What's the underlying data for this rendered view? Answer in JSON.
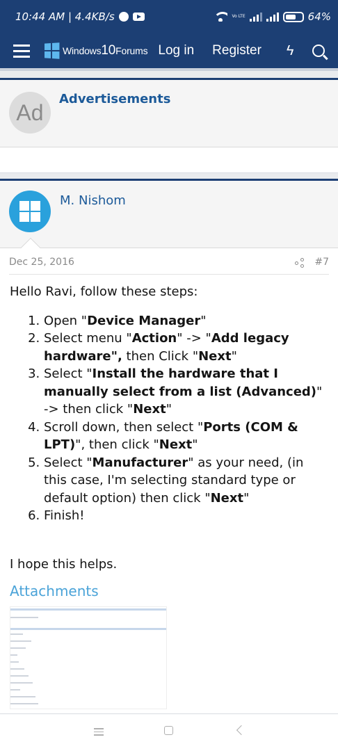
{
  "status_bar": {
    "time_speed": "10:44 AM | 4.4KB/s",
    "battery": "64%",
    "network_label": "Vo LTE"
  },
  "navbar": {
    "logo_prefix": "Windows",
    "logo_ten": "10",
    "logo_suffix": "Forums",
    "login_label": "Log in",
    "register_label": "Register"
  },
  "ad": {
    "avatar_text": "Ad",
    "title": "Advertisements"
  },
  "post": {
    "author": "M. Nishom",
    "date": "Dec 25, 2016",
    "post_number": "#7",
    "greeting": "Hello Ravi, follow these steps:",
    "steps": [
      {
        "pre": "Open \"",
        "bold": "Device Manager",
        "post": "\""
      },
      {
        "pre": "Select menu \"",
        "bold": "Action",
        "mid": "\" -> \"",
        "bold2": "Add legacy hardware\",",
        "post": " then Click \"",
        "bold3": "Next",
        "end": "\""
      },
      {
        "pre": "Select \"",
        "bold": "Install the hardware that I manually select from a list (Advanced)",
        "mid": "\" -> then click \"",
        "bold2": "Next",
        "post": "\""
      },
      {
        "pre": "Scroll down, then select \"",
        "bold": "Ports (COM & LPT)",
        "mid": "\", then click \"",
        "bold2": "Next",
        "post": "\""
      },
      {
        "pre": "Select \"",
        "bold": "Manufacturer",
        "mid": "\" as your need, (in this case, I'm selecting standard type or default option) then click \"",
        "bold2": "Next",
        "post": "\""
      },
      {
        "pre": "Finish!"
      }
    ],
    "closing": "I hope this helps.",
    "attachments_title": "Attachments"
  }
}
